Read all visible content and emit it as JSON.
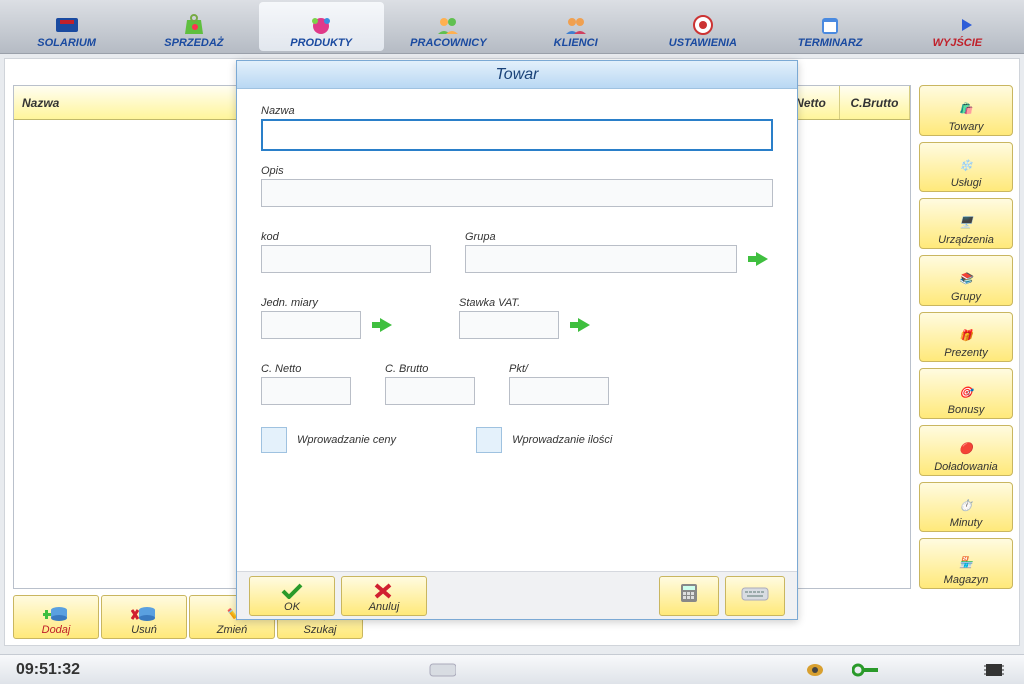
{
  "topnav": [
    {
      "label": "SOLARIUM"
    },
    {
      "label": "SPRZEDAŻ"
    },
    {
      "label": "PRODUKTY"
    },
    {
      "label": "PRACOWNICY"
    },
    {
      "label": "KLIENCI"
    },
    {
      "label": "USTAWIENIA"
    },
    {
      "label": "TERMINARZ"
    },
    {
      "label": "WYJŚCIE"
    }
  ],
  "table": {
    "headers": {
      "nazwa": "Nazwa",
      "cnetto": "C.Netto",
      "cbrutto": "C.Brutto"
    }
  },
  "sidebar": [
    {
      "label": "Towary"
    },
    {
      "label": "Usługi"
    },
    {
      "label": "Urządzenia"
    },
    {
      "label": "Grupy"
    },
    {
      "label": "Prezenty"
    },
    {
      "label": "Bonusy"
    },
    {
      "label": "Doładowania"
    },
    {
      "label": "Minuty"
    },
    {
      "label": "Magazyn"
    }
  ],
  "bottom": {
    "dodaj": "Dodaj",
    "usun": "Usuń",
    "zmien": "Zmień",
    "szukaj": "Szukaj"
  },
  "modal": {
    "title": "Towar",
    "nazwa_label": "Nazwa",
    "opis_label": "Opis",
    "kod_label": "kod",
    "grupa_label": "Grupa",
    "jedn_label": "Jedn. miary",
    "vat_label": "Stawka VAT.",
    "cnetto_label": "C. Netto",
    "cbrutto_label": "C. Brutto",
    "pkt_label": "Pkt/",
    "cena_check": "Wprowadzanie ceny",
    "ilosc_check": "Wprowadzanie ilości",
    "ok": "OK",
    "anuluj": "Anuluj"
  },
  "status": {
    "time": "09:51:32"
  }
}
